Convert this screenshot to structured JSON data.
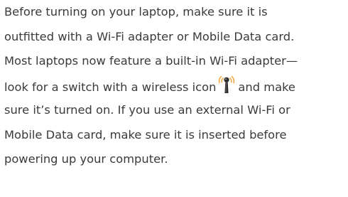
{
  "paragraph": {
    "lines": [
      "Before turning on your laptop, make sure it is",
      "outfitted with a Wi-Fi adapter or Mobile Data card.",
      "Most laptops now feature a built-in Wi-Fi adapter—",
      {
        "before_icon": "look for a switch with a wireless icon",
        "icon": "wireless-icon",
        "after_icon": "and make"
      },
      "sure it’s turned on. If you use an external Wi-Fi or",
      "Mobile Data card, make sure it is inserted before",
      "powering up your computer."
    ]
  },
  "colors": {
    "text": "#3a3a3a",
    "icon_orange": "#f0a030",
    "icon_dark": "#2e2e2e"
  }
}
